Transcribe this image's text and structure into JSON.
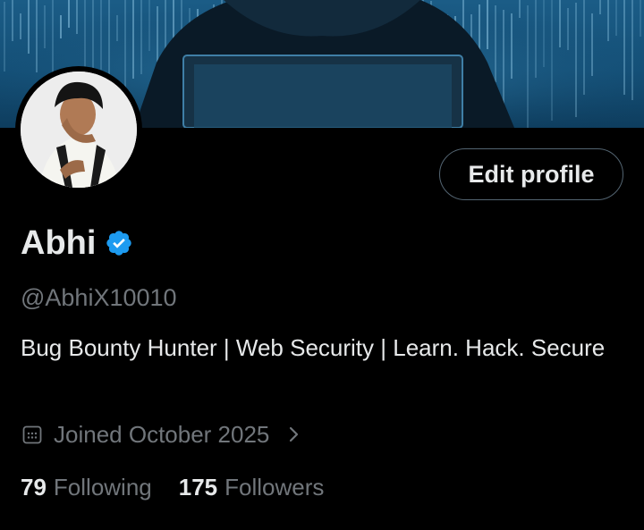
{
  "profile": {
    "display_name": "Abhi",
    "handle": "@AbhiX10010",
    "bio": "Bug Bounty Hunter | Web Security | Learn. Hack. Secure",
    "joined": "Joined October 2025",
    "verified": true
  },
  "actions": {
    "edit_profile_label": "Edit profile"
  },
  "stats": {
    "following_count": "79",
    "following_label": "Following",
    "followers_count": "175",
    "followers_label": "Followers"
  },
  "icons": {
    "verified": "verified-badge-icon",
    "calendar": "calendar-icon",
    "chevron": "chevron-right-icon"
  },
  "colors": {
    "background": "#000000",
    "text_primary": "#e7e9ea",
    "text_secondary": "#71767b",
    "button_border": "#536471",
    "verified_blue": "#1d9bf0",
    "banner_blue": "#1b5c86"
  }
}
